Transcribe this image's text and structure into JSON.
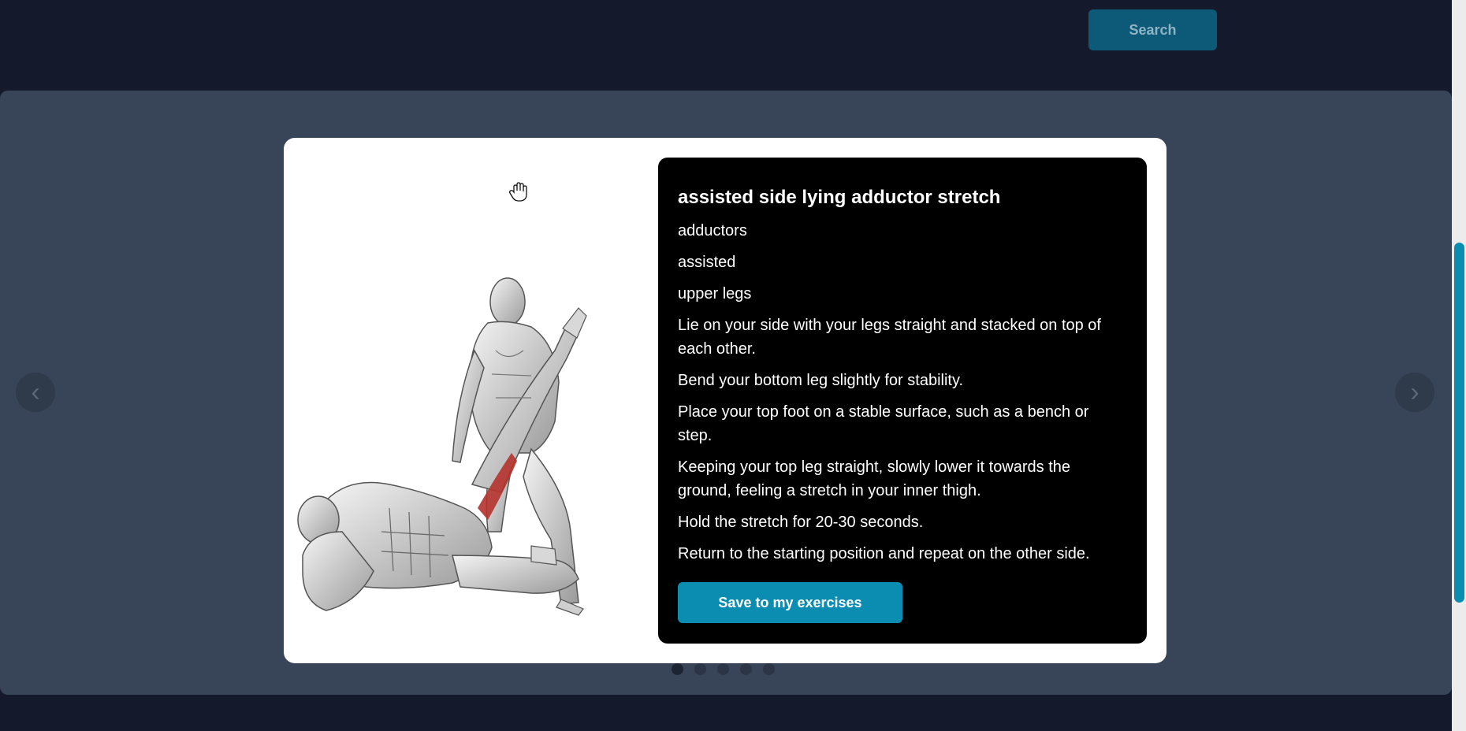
{
  "header": {
    "search_label": "Search"
  },
  "carousel": {
    "prev_icon": "chevron-left-icon",
    "next_icon": "chevron-right-icon",
    "dot_count": 5,
    "active_dot": 1
  },
  "exercise": {
    "name": "assisted side lying adductor stretch",
    "target": "adductors",
    "equipment": "assisted",
    "body_part": "upper legs",
    "instructions": [
      "Lie on your side with your legs straight and stacked on top of each other.",
      "Bend your bottom leg slightly for stability.",
      "Place your top foot on a stable surface, such as a bench or step.",
      "Keeping your top leg straight, slowly lower it towards the ground, feeling a stretch in your inner thigh.",
      "Hold the stretch for 20-30 seconds.",
      "Return to the starting position and repeat on the other side."
    ],
    "save_label": "Save to my exercises"
  },
  "colors": {
    "accent": "#0b8db2",
    "page_bg": "#141a2b",
    "backdrop": "#384457",
    "highlight_muscle": "#b5322e"
  }
}
